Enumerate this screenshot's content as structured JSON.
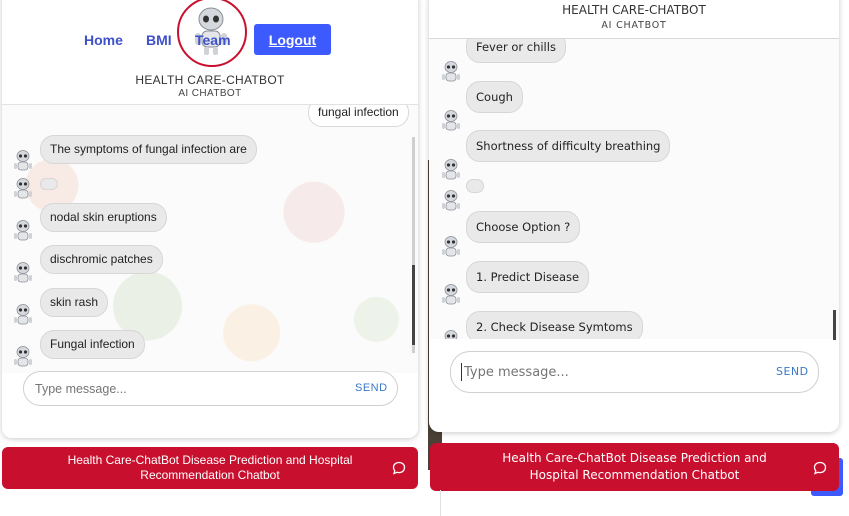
{
  "left": {
    "nav": {
      "home": "Home",
      "bmi": "BMI",
      "team": "Team",
      "logout": "Logout"
    },
    "brand": {
      "title": "HEALTH CARE-CHATBOT",
      "subtitle": "AI CHATBOT"
    },
    "messages": [
      {
        "from": "user",
        "text": "fungal infection"
      },
      {
        "from": "bot",
        "text": "The symptoms of fungal infection are"
      },
      {
        "from": "bot",
        "text": ""
      },
      {
        "from": "bot",
        "text": "nodal skin eruptions"
      },
      {
        "from": "bot",
        "text": "dischromic patches"
      },
      {
        "from": "bot",
        "text": "skin rash"
      },
      {
        "from": "bot",
        "text": "Fungal infection"
      }
    ],
    "input": {
      "placeholder": "Type message...",
      "send": "SEND"
    },
    "banner": "Health Care-ChatBot Disease Prediction and Hospital Recommendation Chatbot"
  },
  "right": {
    "brand": {
      "title": "HEALTH CARE-CHATBOT",
      "subtitle": "AI CHATBOT"
    },
    "messages": [
      {
        "from": "bot",
        "text": "Fever or chills"
      },
      {
        "from": "bot",
        "text": "Cough"
      },
      {
        "from": "bot",
        "text": "Shortness of difficulty breathing"
      },
      {
        "from": "bot",
        "text": ""
      },
      {
        "from": "bot",
        "text": "Choose Option ?"
      },
      {
        "from": "bot",
        "text": "1. Predict Disease"
      },
      {
        "from": "bot",
        "text": "2. Check Disease Symtoms"
      }
    ],
    "input": {
      "placeholder": "Type message...",
      "send": "SEND"
    },
    "banner": "Health Care-ChatBot Disease Prediction and Hospital Recommendation Chatbot"
  },
  "colors": {
    "brand_red": "#c8102e",
    "accent_blue": "#3d5afe",
    "nav_blue": "#3f51c9"
  },
  "icons": {
    "bot": "robot-icon",
    "chat": "chat-bubble-icon"
  }
}
